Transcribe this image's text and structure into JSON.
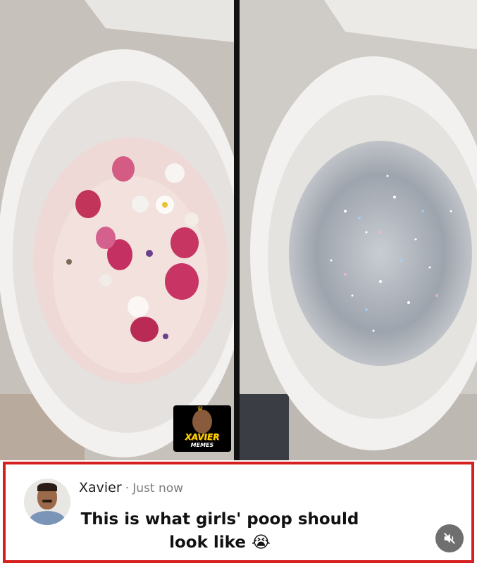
{
  "watermark": {
    "label": "XAVIER",
    "sub": "MEMES"
  },
  "comment": {
    "author": "Xavier",
    "separator": "·",
    "time": "Just now",
    "text_line1": "This is what girls' poop should",
    "text_line2": "look like",
    "emoji": "😭"
  },
  "icons": {
    "avatar": "avatar-photo",
    "mute": "speaker-muted-icon"
  },
  "colors": {
    "frame_border": "#d6201f",
    "mute_button": "#6f6f6f"
  }
}
